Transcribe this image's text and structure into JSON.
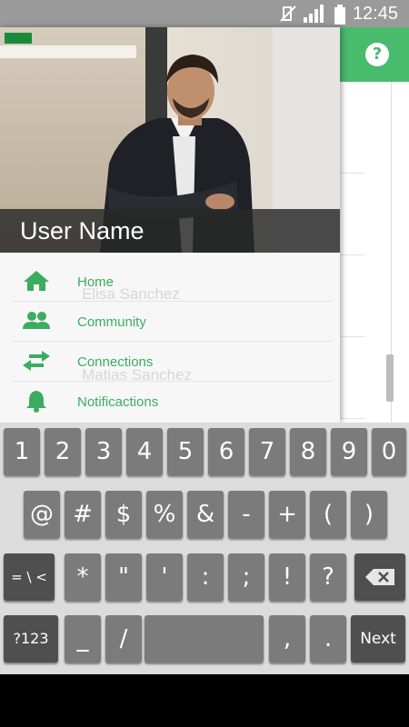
{
  "status_bar": {
    "time": "12:45",
    "icons": [
      "mute-icon",
      "signal-icon",
      "battery-icon"
    ]
  },
  "background_app": {
    "help_label": "?",
    "ghost_names": [
      "Elisa Sanchez",
      "Matias Sanchez"
    ],
    "accent": "#48bb6d"
  },
  "drawer": {
    "user_name": "User Name",
    "menu": [
      {
        "label": "Home",
        "icon": "home-icon"
      },
      {
        "label": "Community",
        "icon": "community-icon"
      },
      {
        "label": "Connections",
        "icon": "connections-icon"
      },
      {
        "label": "Notificactions",
        "icon": "bell-icon"
      }
    ]
  },
  "keyboard": {
    "row1": [
      "1",
      "2",
      "3",
      "4",
      "5",
      "6",
      "7",
      "8",
      "9",
      "0"
    ],
    "row2": [
      "@",
      "#",
      "$",
      "%",
      "&",
      "-",
      "+",
      "(",
      ")"
    ],
    "row3": [
      "= \\ <",
      "*",
      "\"",
      "'",
      ":",
      ";",
      "!",
      "?"
    ],
    "row4": [
      "?123",
      "_",
      "/",
      " ",
      ",",
      ".",
      "Next"
    ]
  }
}
